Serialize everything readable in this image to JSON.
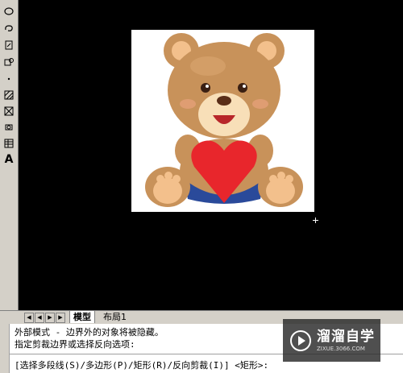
{
  "tabs": {
    "model": "模型",
    "layout1": "布局1"
  },
  "command_lines": {
    "line1": "外部模式 - 边界外的对象将被隐藏。",
    "line2": "指定剪裁边界或选择反向选项:",
    "line3": "[选择多段线(S)/多边形(P)/矩形(R)/反向剪裁(I)] <矩形>:"
  },
  "watermark": {
    "title": "溜溜自学",
    "url": "ZIXUE.3066.COM"
  },
  "toolbar_icons": [
    "ellipse-icon",
    "revcloud-icon",
    "insert-block-icon",
    "make-block-icon",
    "point-icon",
    "hatch-icon",
    "gradient-icon",
    "region-icon",
    "table-icon",
    "text-icon"
  ],
  "colors": {
    "canvas": "#000000",
    "panel": "#d4d0c8",
    "bear_fur": "#c8925a",
    "heart": "#e8262c"
  }
}
